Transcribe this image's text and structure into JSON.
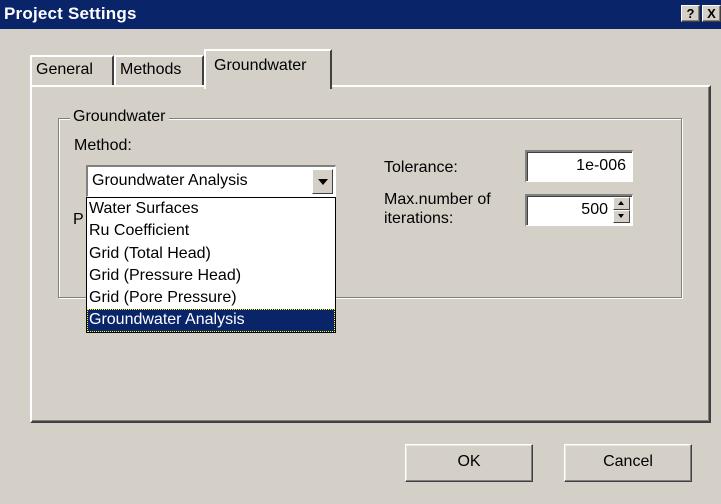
{
  "window": {
    "title": "Project Settings",
    "help_label": "?",
    "close_label": "X"
  },
  "tabs": [
    {
      "label": "General"
    },
    {
      "label": "Methods"
    },
    {
      "label": "Groundwater",
      "active": true
    }
  ],
  "group": {
    "title": "Groundwater",
    "method_label": "Method:",
    "method_value": "Groundwater Analysis",
    "hidden_label_fragment": "P",
    "options": [
      "Water Surfaces",
      "Ru Coefficient",
      "Grid (Total Head)",
      "Grid (Pressure Head)",
      "Grid (Pore Pressure)",
      "Groundwater Analysis"
    ],
    "selected_option": "Groundwater Analysis",
    "tolerance_label": "Tolerance:",
    "tolerance_value": "1e-006",
    "max_iter_label_line1": "Max.number of",
    "max_iter_label_line2": "iterations:",
    "max_iter_value": "500"
  },
  "buttons": {
    "ok": "OK",
    "cancel": "Cancel"
  },
  "colors": {
    "titlebar": "#0a246a",
    "face": "#d4d0c8",
    "selection": "#0a246a"
  }
}
